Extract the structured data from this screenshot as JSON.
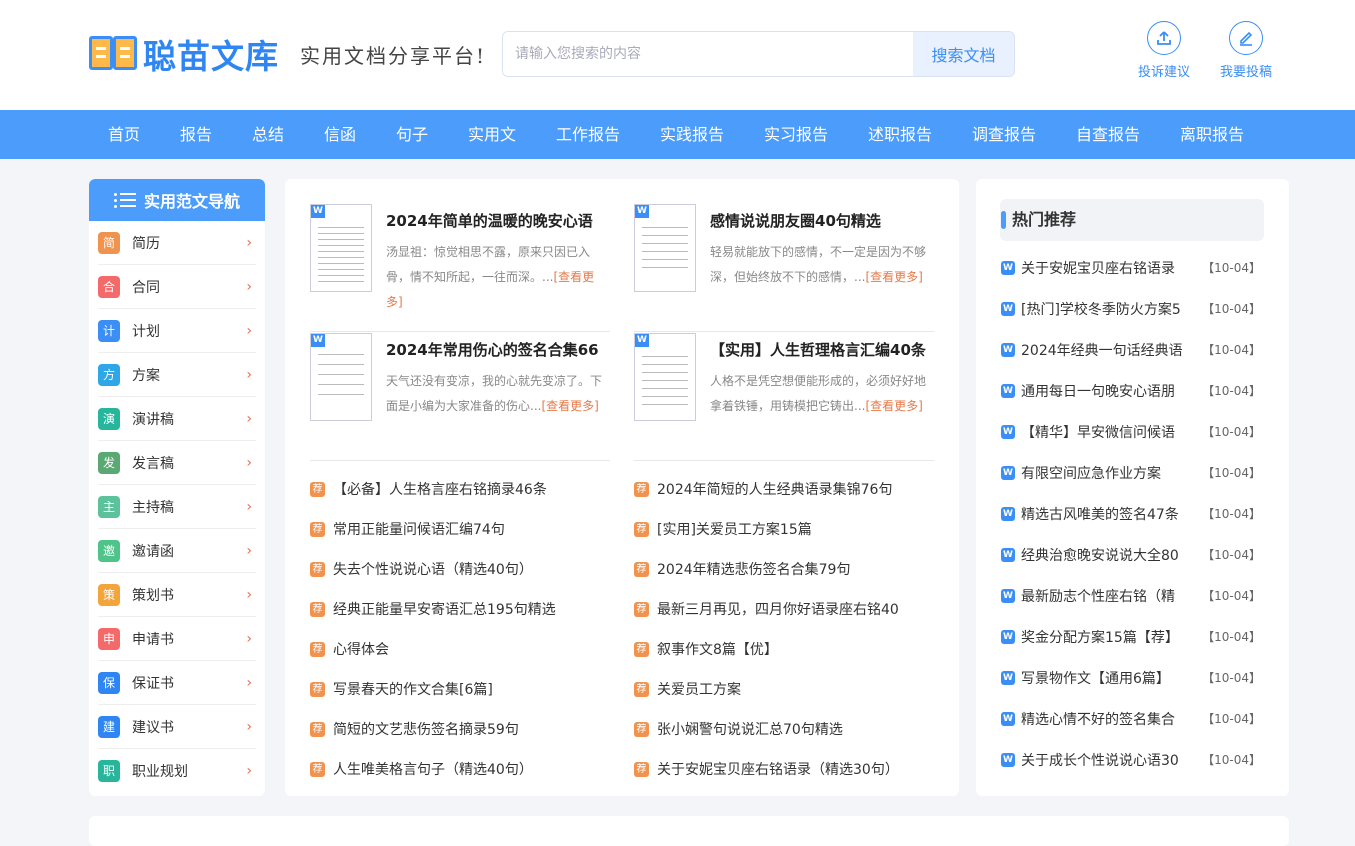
{
  "header": {
    "logo_text": "聪苗文库",
    "slogan": "实用文档分享平台!",
    "search": {
      "placeholder": "请输入您搜索的内容",
      "button": "搜索文档"
    },
    "actions": [
      {
        "label": "投诉建议",
        "icon": "upload-icon"
      },
      {
        "label": "我要投稿",
        "icon": "edit-icon"
      }
    ]
  },
  "nav": [
    "首页",
    "报告",
    "总结",
    "信函",
    "句子",
    "实用文",
    "工作报告",
    "实践报告",
    "实习报告",
    "述职报告",
    "调查报告",
    "自查报告",
    "离职报告"
  ],
  "sidebar": {
    "title": "实用范文导航",
    "items": [
      {
        "tag": "简",
        "label": "简历",
        "color": "#f0934e"
      },
      {
        "tag": "合",
        "label": "合同",
        "color": "#f46a6a"
      },
      {
        "tag": "计",
        "label": "计划",
        "color": "#3a8ef5"
      },
      {
        "tag": "方",
        "label": "方案",
        "color": "#2fa6e8"
      },
      {
        "tag": "演",
        "label": "演讲稿",
        "color": "#27b59c"
      },
      {
        "tag": "发",
        "label": "发言稿",
        "color": "#5aa872"
      },
      {
        "tag": "主",
        "label": "主持稿",
        "color": "#5cc29b"
      },
      {
        "tag": "邀",
        "label": "邀请函",
        "color": "#4ec38a"
      },
      {
        "tag": "策",
        "label": "策划书",
        "color": "#f3a43a"
      },
      {
        "tag": "申",
        "label": "申请书",
        "color": "#f46a6a"
      },
      {
        "tag": "保",
        "label": "保证书",
        "color": "#2f86f2"
      },
      {
        "tag": "建",
        "label": "建议书",
        "color": "#2f86f2"
      },
      {
        "tag": "职",
        "label": "职业规划",
        "color": "#27b59c"
      }
    ]
  },
  "main": {
    "more_label": "[查看更多]",
    "cards": [
      {
        "title": "2024年简单的温暖的晚安心语",
        "desc": "汤显祖：惊觉相思不露，原来只因已入骨，情不知所起，一往而深。..."
      },
      {
        "title": "感情说说朋友圈40句精选",
        "desc": "轻易就能放下的感情，不一定是因为不够深，但始终放不下的感情，..."
      },
      {
        "title": "2024年常用伤心的签名合集66",
        "desc": "天气还没有变凉，我的心就先变凉了。下面是小编为大家准备的伤心..."
      },
      {
        "title": "【实用】人生哲理格言汇编40条",
        "desc": "人格不是凭空想便能形成的，必须好好地拿着铁锤，用铸模把它铸出..."
      }
    ],
    "rec_badge": "荐",
    "list_left": [
      "【必备】人生格言座右铭摘录46条",
      "常用正能量问候语汇编74句",
      "失去个性说说心语（精选40句）",
      "经典正能量早安寄语汇总195句精选",
      "心得体会",
      "写景春天的作文合集[6篇]",
      "简短的文艺悲伤签名摘录59句",
      "人生唯美格言句子（精选40句）"
    ],
    "list_right": [
      "2024年简短的人生经典语录集锦76句",
      "[实用]关爱员工方案15篇",
      "2024年精选悲伤签名合集79句",
      "最新三月再见，四月你好语录座右铭40",
      "叙事作文8篇【优】",
      "关爱员工方案",
      "张小娴警句说说汇总70句精选",
      "关于安妮宝贝座右铭语录（精选30句）"
    ]
  },
  "hot": {
    "title": "热门推荐",
    "items": [
      {
        "title": "关于安妮宝贝座右铭语录",
        "date": "【10-04】"
      },
      {
        "title": "[热门]学校冬季防火方案5",
        "date": "【10-04】"
      },
      {
        "title": "2024年经典一句话经典语",
        "date": "【10-04】"
      },
      {
        "title": "通用每日一句晚安心语朋",
        "date": "【10-04】"
      },
      {
        "title": "【精华】早安微信问候语",
        "date": "【10-04】"
      },
      {
        "title": "有限空间应急作业方案",
        "date": "【10-04】"
      },
      {
        "title": "精选古风唯美的签名47条",
        "date": "【10-04】"
      },
      {
        "title": "经典治愈晚安说说大全80",
        "date": "【10-04】"
      },
      {
        "title": "最新励志个性座右铭（精",
        "date": "【10-04】"
      },
      {
        "title": "奖金分配方案15篇【荐】",
        "date": "【10-04】"
      },
      {
        "title": "写景物作文【通用6篇】",
        "date": "【10-04】"
      },
      {
        "title": "精选心情不好的签名集合",
        "date": "【10-04】"
      },
      {
        "title": "关于成长个性说说心语30",
        "date": "【10-04】"
      }
    ]
  }
}
